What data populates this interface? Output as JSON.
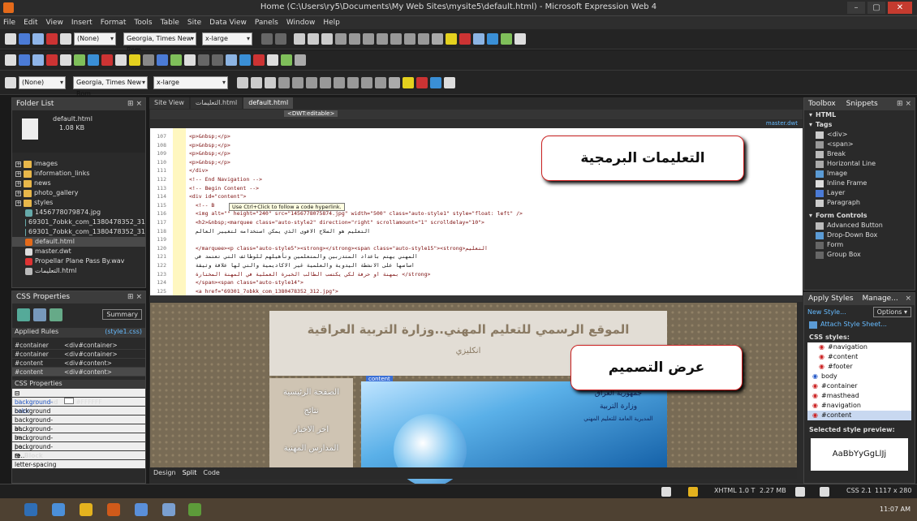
{
  "window": {
    "title": "Home (C:\\Users\\ry5\\Documents\\My Web Sites\\mysite5\\default.html) - Microsoft Expression Web 4",
    "minimize": "–",
    "restore": "▢",
    "close": "✕"
  },
  "menu": [
    "File",
    "Edit",
    "View",
    "Insert",
    "Format",
    "Tools",
    "Table",
    "Site",
    "Data View",
    "Panels",
    "Window",
    "Help"
  ],
  "toolbar1": {
    "style": "(None)",
    "font": "Georgia, Times New Rom",
    "size": "x-large"
  },
  "toolbar3": {
    "style": "(None)",
    "font": "Georgia, Times New Rom",
    "size": "x-large"
  },
  "folder_list": {
    "title": "Folder List",
    "file_name": "default.html",
    "file_size": "1.08 KB",
    "items": [
      "images",
      "information_links",
      "news",
      "photo_gallery",
      "styles",
      "1456778079874.jpg",
      "69301_7obkk_com_1380478352_31",
      "69301_7obkk_com_1380478352_31",
      "default.html",
      "master.dwt",
      "Propellar Plane Pass By.wav",
      "التعليمات.html"
    ]
  },
  "css_props": {
    "title": "CSS Properties",
    "summary": "Summary",
    "applied_rules_label": "Applied Rules",
    "applied_link": "(style1.css)",
    "rules": [
      [
        "#container",
        "<div#container>"
      ],
      [
        "#container",
        "<div#container>"
      ],
      [
        "#content",
        "<div#content>"
      ],
      [
        "#content",
        "<div#content>"
      ]
    ],
    "props_label": "CSS Properties",
    "background_group": "Background",
    "background_color_name": "background-color",
    "background_color_value": "#FFFFFF",
    "prop_names": [
      "background",
      "background-at...",
      "background-im...",
      "background-po...",
      "background-re..."
    ],
    "block_group": "Block",
    "letter_spacing": "letter-spacing"
  },
  "tabs": [
    "Site View",
    "التعليمات.html",
    "default.html"
  ],
  "breadcrumb": "<DWT:editable>",
  "master_label": "master.dwt",
  "tooltip": "Use Ctrl+Click to follow a code hyperlink.",
  "code": {
    "line_numbers": [
      "107",
      "108",
      "109",
      "110",
      "111",
      "112",
      "113",
      "114",
      "115",
      "116",
      "117",
      "118",
      "119",
      "120",
      "121",
      "122",
      "123",
      "124",
      "125"
    ],
    "lines": [
      "<p>&nbsp;</p>",
      "<p>&nbsp;</p>",
      "<p>&nbsp;</p>",
      "<p>&nbsp;</p>",
      "</div>",
      "<!-- End Navigation -->",
      "<!-- Begin Content -->",
      "<div id=\"content\">",
      "  <!-- B",
      "  <img alt=\"\" height=\"240\" src=\"1456778075874.jpg\" width=\"500\" class=\"auto-style1\" style=\"float: left\" />",
      "  <h2>&nbsp;<marquee class=\"auto-style2\" direction=\"right\" scrollamount=\"1\" scrolldelay=\"10\">",
      "  التعليم هو السلاح الاقوى الذي يمكن استخدامه لتغيير العالم",
      "",
      "  </marquee><p class=\"auto-style5\"><strong></strong><span class=\"auto-style15\"><strong>التعليم",
      "  المهني يهتم باعداد المتدربين والمتعلمين وتأهيلهم للوظائف التي تعتمد في",
      "  اساسها على الانشطة اليدوية والعلمية غير الاكاديمية والتي لها علاقة وثيقة",
      "  بمهنة او حرفة لكي يكتسب الطالب الخبرة العملية في المهنة المختارة </strong>",
      "  </span><span class=\"auto-style14\">",
      "  <a href=\"69301_7obkk_com_1380478352_312.jpg\">"
    ]
  },
  "overlay_code": "التعليمات البرمجية",
  "overlay_design": "عرض التصميم",
  "design": {
    "site_title": "الموقع الرسمي للتعليم المهني..وزارة التربية العراقية",
    "english_link": "انكليزي",
    "content_tag": "content",
    "nav_items": [
      "الصفحة الرئيسية",
      "نتائج",
      "اخر الاخبار",
      "المدارس المهنية"
    ],
    "photo_text": [
      "جمهورية العراق",
      "وزارة التربية",
      "المديرية العامة للتعليم المهني"
    ]
  },
  "view_tabs": [
    "Design",
    "Split",
    "Code"
  ],
  "toolbox": {
    "tabs": [
      "Toolbox",
      "Snippets"
    ],
    "html_group": "HTML",
    "tags_group": "Tags",
    "tags": [
      "<div>",
      "<span>",
      "Break",
      "Horizontal Line",
      "Image",
      "Inline Frame",
      "Layer",
      "Paragraph"
    ],
    "form_group": "Form Controls",
    "forms": [
      "Advanced Button",
      "Drop-Down Box",
      "Form",
      "Group Box"
    ]
  },
  "apply_styles": {
    "tabs": [
      "Apply Styles",
      "Manage..."
    ],
    "new_style": "New Style...",
    "options": "Options",
    "attach": "Attach Style Sheet...",
    "css_styles_label": "CSS styles:",
    "styles": [
      "#navigation",
      "#content",
      "#footer",
      "body",
      "#container",
      "#masthead",
      "#navigation",
      "#content"
    ],
    "preview_label": "Selected style preview:",
    "preview_text": "AaBbYyGgLlJj"
  },
  "status": {
    "doctype": "XHTML 1.0 T",
    "size": "2.27 MB",
    "css": "CSS 2.1",
    "dimensions": "1117 x 280"
  },
  "taskbar": {
    "time": "11:07 AM"
  },
  "colors": {
    "accent": "#c22020",
    "overlay_border": "#c22222"
  }
}
